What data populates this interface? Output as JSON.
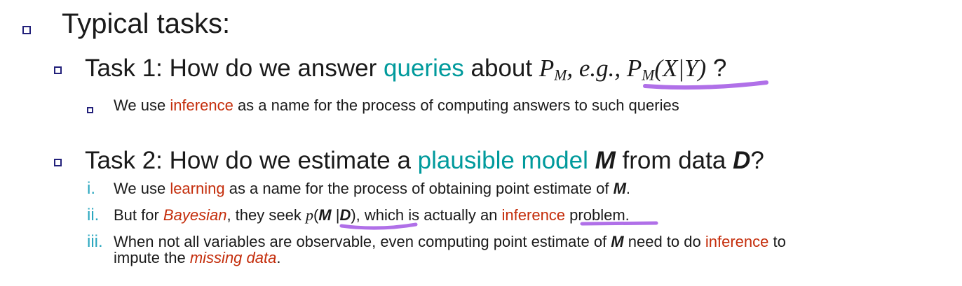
{
  "level1": {
    "text": "Typical tasks:"
  },
  "task1": {
    "prefix": "Task 1: How do we answer ",
    "highlight": "queries",
    "middle": " about ",
    "p": "P",
    "p_sub": "M",
    "eg": ", e.g., ",
    "p2": "P",
    "p2_sub": "M",
    "p2_arg": "(X|Y)",
    "suffix": " ?",
    "sub_bullet": {
      "prefix": "We use ",
      "highlight": "inference",
      "suffix": " as a name for the process of computing answers to such queries"
    }
  },
  "task2": {
    "prefix": "Task 2: How do we estimate a ",
    "highlight": "plausible model",
    "m": "M",
    "middle": " from data ",
    "d": "D",
    "suffix": "?",
    "items": [
      {
        "numeral": "i.",
        "prefix": "We use ",
        "highlight": "learning",
        "suffix": " as a name for the process of obtaining point estimate of ",
        "m": "M",
        "end": "."
      },
      {
        "numeral": "ii.",
        "prefix": "But for ",
        "bayesian": "Bayesian",
        "mid": ", they seek ",
        "p": "p",
        "paren_open": "(",
        "m": "M",
        "bar": " |",
        "d": "D",
        "paren_close": ")",
        "mid2": ", which is actually an ",
        "highlight": "inference",
        "suffix": " problem."
      },
      {
        "numeral": "iii.",
        "prefix": "When not all variables are observable, even computing point estimate of ",
        "m": "M",
        "mid": " need to do ",
        "highlight": "inference",
        "suffix": " to",
        "line2_prefix": "impute the ",
        "line2_em": "missing data",
        "line2_end": "."
      }
    ]
  },
  "colors": {
    "teal": "#009a9c",
    "red": "#c42d0b",
    "bullet_border": "#22207a",
    "numeral": "#2aa7bf",
    "pen": "#b070e8"
  }
}
